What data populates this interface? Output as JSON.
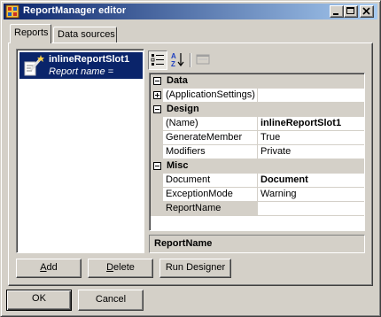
{
  "window": {
    "title": "ReportManager editor",
    "buttons": {
      "minimize": "minimize",
      "maximize": "maximize",
      "close": "close"
    }
  },
  "tabs": [
    {
      "label": "Reports",
      "selected": true
    },
    {
      "label": "Data sources",
      "selected": false
    }
  ],
  "report_list": {
    "items": [
      {
        "name": "inlineReportSlot1",
        "subtitle": "Report name =",
        "selected": true,
        "icon": "report-wand-icon"
      }
    ]
  },
  "property_grid": {
    "toolbar": [
      {
        "name": "categorized",
        "icon": "categorized-icon",
        "pressed": true
      },
      {
        "name": "alphabetical",
        "icon": "alphabetical-sort-icon",
        "pressed": false
      },
      {
        "name": "property-pages",
        "icon": "property-pages-icon",
        "pressed": false,
        "disabled": true
      }
    ],
    "rows": [
      {
        "kind": "category",
        "label": "Data",
        "expanded": true
      },
      {
        "kind": "property",
        "name": "(ApplicationSettings)",
        "value": "",
        "expandable": true,
        "bold": false
      },
      {
        "kind": "category",
        "label": "Design",
        "expanded": true
      },
      {
        "kind": "property",
        "name": "(Name)",
        "value": "inlineReportSlot1",
        "bold": true
      },
      {
        "kind": "property",
        "name": "GenerateMember",
        "value": "True",
        "bold": false
      },
      {
        "kind": "property",
        "name": "Modifiers",
        "value": "Private",
        "bold": false
      },
      {
        "kind": "category",
        "label": "Misc",
        "expanded": true
      },
      {
        "kind": "property",
        "name": "Document",
        "value": "Document",
        "bold": true
      },
      {
        "kind": "property",
        "name": "ExceptionMode",
        "value": "Warning",
        "bold": false
      },
      {
        "kind": "property",
        "name": "ReportName",
        "value": "",
        "bold": false,
        "selected": true
      }
    ],
    "description": {
      "title": "ReportName"
    }
  },
  "buttons": {
    "add": {
      "label": "Add",
      "mnemonic": "A"
    },
    "delete": {
      "label": "Delete",
      "mnemonic": "D"
    },
    "run_designer": "Run Designer",
    "ok": "OK",
    "cancel": "Cancel"
  },
  "colors": {
    "face": "#d4d0c8",
    "selection": "#0a246a",
    "titlebar_start": "#0a246a",
    "titlebar_end": "#a6caf0"
  }
}
